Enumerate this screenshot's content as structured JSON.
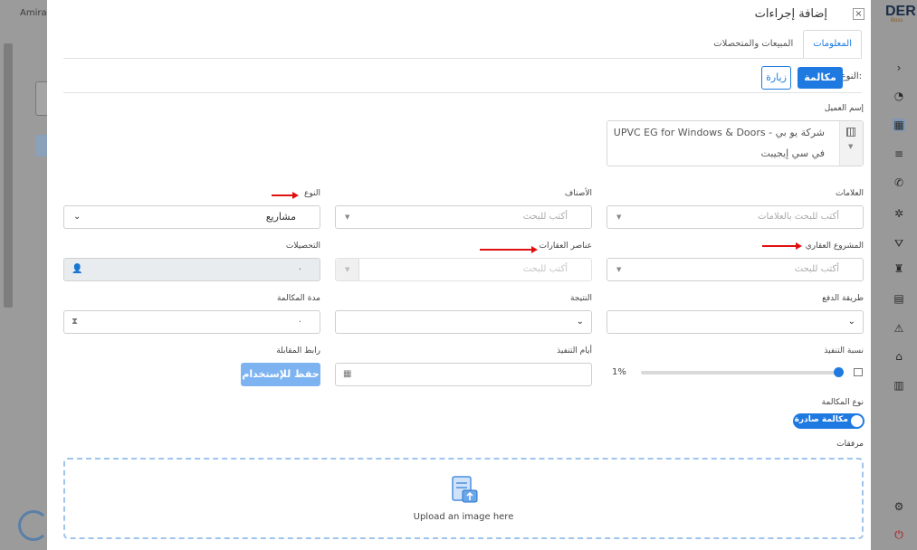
{
  "background": {
    "user_name": "Amira",
    "logo": "DER",
    "logo_sub": "Boss"
  },
  "modal": {
    "title": "إضافة إجراءات",
    "close_label": "×"
  },
  "tabs": [
    {
      "label": "المعلومات",
      "active": true
    },
    {
      "label": "المبيعات والمتحصلات",
      "active": false
    }
  ],
  "action_type": {
    "label": "النوع:",
    "options": [
      "مكالمة",
      "زيارة"
    ],
    "selected": "مكالمة"
  },
  "client": {
    "label": "إسم العميل",
    "line1": "UPVC EG for Windows & Doors - شركة يو بي",
    "line2": "في سي إيجيبت"
  },
  "fields": {
    "tags": {
      "label": "العلامات",
      "placeholder": "أكتب للبحث بالعلامات"
    },
    "categories": {
      "label": "الأصناف",
      "placeholder": "أكتب للبحث"
    },
    "type": {
      "label": "النوع",
      "value": "مشاريع"
    },
    "real_estate_project": {
      "label": "المشروع العقاري",
      "placeholder": "أكتب للبحث"
    },
    "real_estate_items": {
      "label": "عناصر العقارات",
      "placeholder": "أكتب للبحث"
    },
    "collections": {
      "label": "التحصيلات",
      "value": "."
    },
    "payment_method": {
      "label": "طريقة الدفع",
      "value": ""
    },
    "result": {
      "label": "النتيجة",
      "value": ""
    },
    "call_duration": {
      "label": "مدة المكالمة",
      "value": "."
    },
    "completion_rate": {
      "label": "نسبة التنفيذ",
      "value": "1%",
      "fraction": 0.01
    },
    "execution_days": {
      "label": "أيام التنفيذ",
      "value": ""
    },
    "meeting_link": {
      "label": "رابط المقابلة",
      "button": "حفظ للإستخدام"
    },
    "call_kind": {
      "label": "نوع المكالمة",
      "value": "مكالمة صادرة"
    },
    "attachments": {
      "label": "مرفقات",
      "upload_text": "Upload an image here"
    }
  },
  "colors": {
    "primary": "#1e7ae0",
    "annotation_arrow": "#e01010"
  }
}
